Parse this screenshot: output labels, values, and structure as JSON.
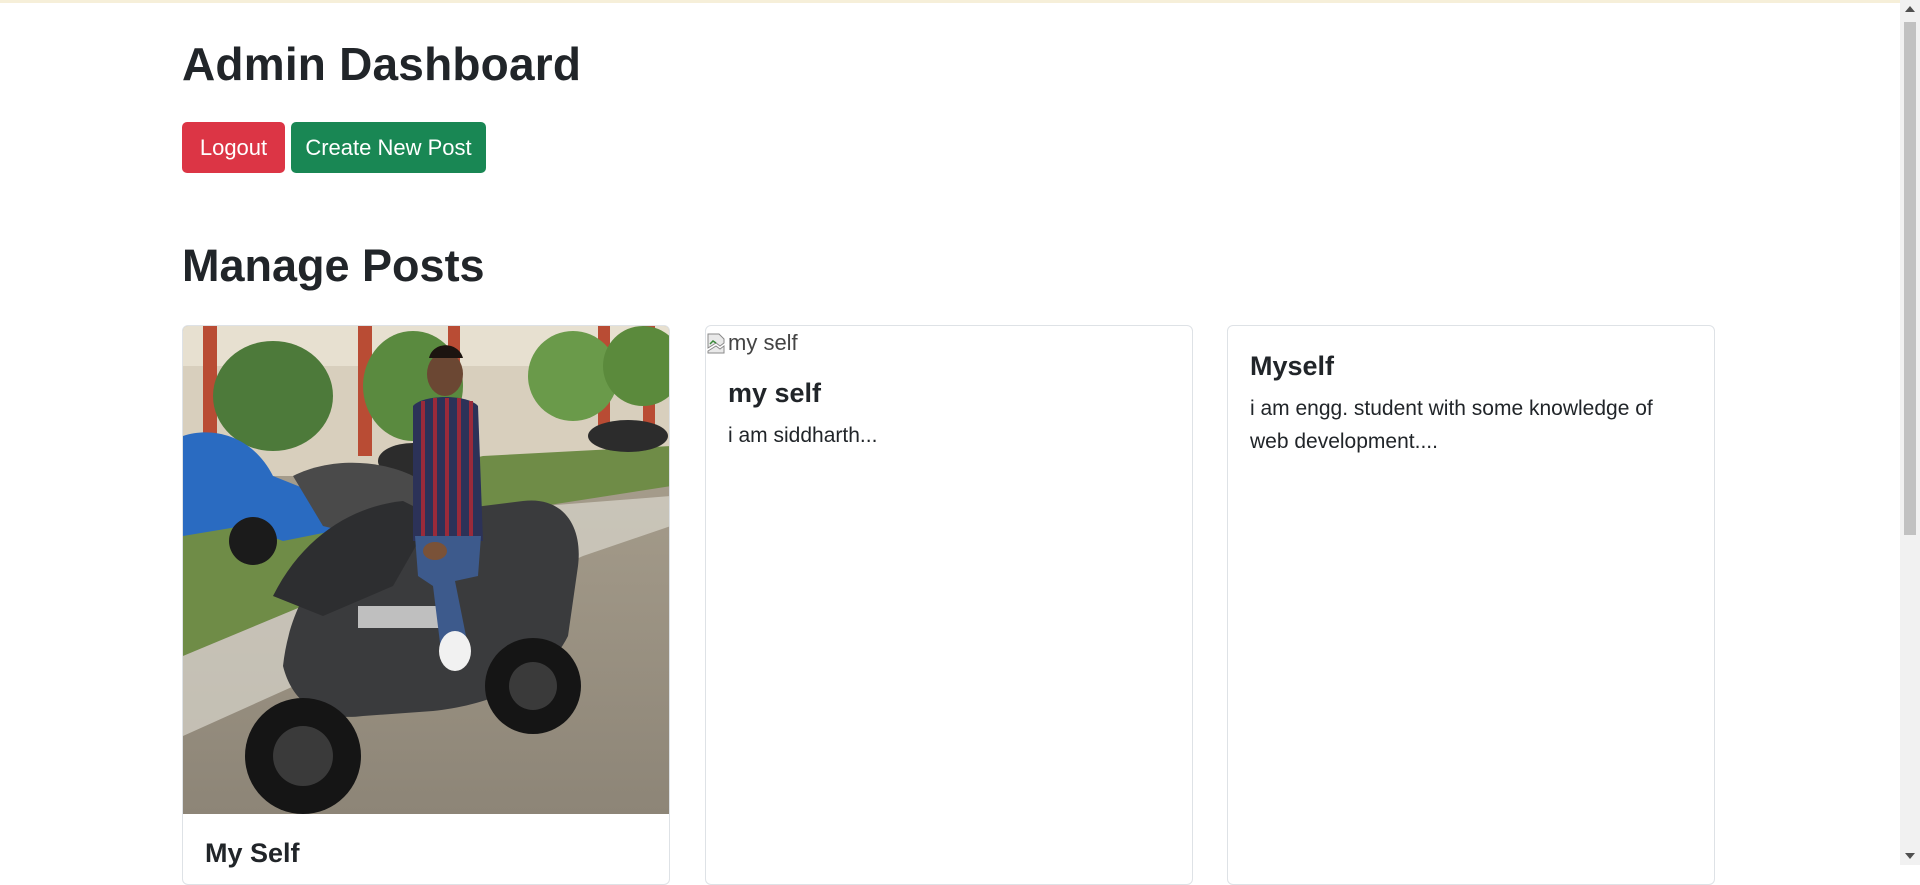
{
  "header": {
    "title": "Admin Dashboard",
    "logout_label": "Logout",
    "create_label": "Create New Post"
  },
  "main": {
    "section_title": "Manage Posts",
    "posts": [
      {
        "image_alt": "",
        "title": "My Self",
        "text": ""
      },
      {
        "image_alt": "my self",
        "title": "my self",
        "text": "i am siddharth..."
      },
      {
        "image_alt": "",
        "title": "Myself",
        "text": "i am engg. student with some knowledge of web development...."
      }
    ]
  },
  "colors": {
    "logout_bg": "#dc3545",
    "create_bg": "#198754",
    "text": "#212529",
    "card_border": "#dee2e6"
  },
  "icons": [
    "broken-image-icon",
    "scroll-up-arrow-icon",
    "scroll-down-arrow-icon"
  ]
}
